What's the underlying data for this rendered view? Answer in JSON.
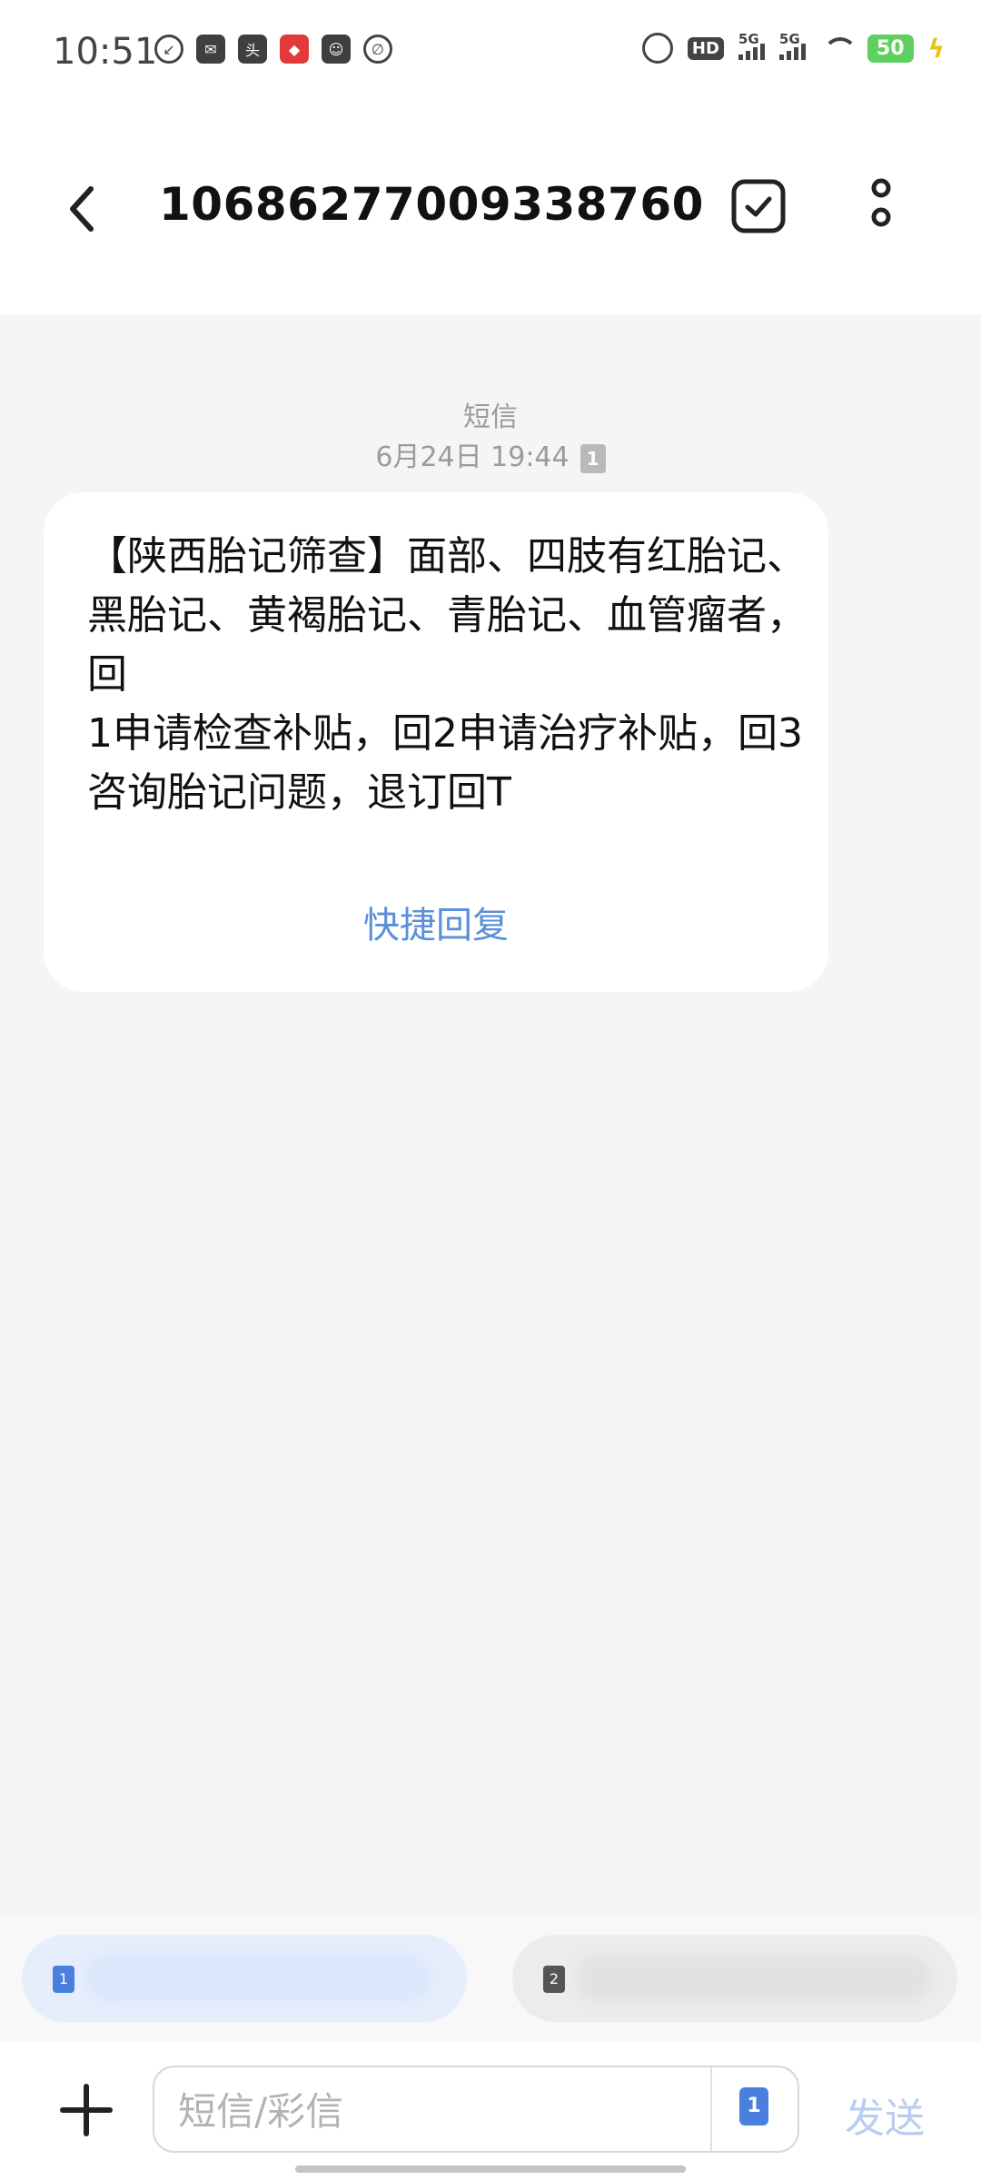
{
  "status_bar": {
    "time": "10:51",
    "icons_left": [
      "missed-call-icon",
      "mail-icon",
      "toutiao-icon",
      "red-app-icon",
      "app-icon",
      "leaf-icon"
    ],
    "icons_right": [
      "alarm-icon",
      "hd-icon",
      "5g-signal-icon",
      "5g-signal-icon",
      "wifi-icon",
      "battery-icon",
      "charging-icon"
    ],
    "hd_label": "HD",
    "signal_label": "5G",
    "battery": "50"
  },
  "header": {
    "title": "10686277009338760",
    "back_icon": "chevron-left-icon",
    "select_icon": "checkbox-icon",
    "more_icon": "more-vertical-icon"
  },
  "conversation": {
    "message_type": "短信",
    "date": "6月24日 19:44",
    "sim_slot": "1",
    "message_text": "【陕西胎记筛查】面部、四肢有红胎记、黑胎记、黄褐胎记、青胎记、血管瘤者，回\n1申请检查补贴，回2申请治疗补贴，回3咨询胎记问题，退订回T",
    "quick_reply": "快捷回复"
  },
  "suggestions": {
    "sim_one": "1",
    "sim_two": "2"
  },
  "input_bar": {
    "placeholder": "短信/彩信",
    "sim": "1",
    "send_label": "发送"
  },
  "colors": {
    "accent": "#5b8fd9",
    "send_disabled": "#b8cdef",
    "background": "#f5f5f5",
    "battery": "#5fcf5f"
  }
}
